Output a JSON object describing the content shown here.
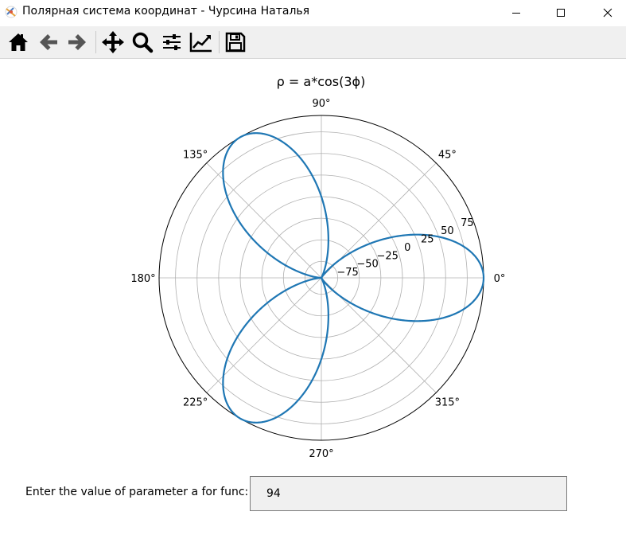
{
  "window": {
    "title": "Полярная система координат - Чурсина Наталья",
    "controls": [
      "minimize-icon",
      "maximize-icon",
      "close-icon"
    ]
  },
  "toolbar": {
    "tools": [
      {
        "name": "home",
        "icon": "home-icon"
      },
      {
        "name": "back",
        "icon": "arrow-left-icon"
      },
      {
        "name": "forward",
        "icon": "arrow-right-icon"
      },
      {
        "name": "pan",
        "icon": "move-icon"
      },
      {
        "name": "zoom",
        "icon": "zoom-icon"
      },
      {
        "name": "configure-subplots",
        "icon": "sliders-icon"
      },
      {
        "name": "edit-axis",
        "icon": "chart-line-icon"
      },
      {
        "name": "save",
        "icon": "floppy-disk-icon"
      }
    ]
  },
  "plot": {
    "title": "ρ = a*cos(3ϕ)",
    "line_color": "#1f77b4"
  },
  "chart_data": {
    "type": "line",
    "projection": "polar",
    "title": "ρ = a*cos(3ϕ)",
    "function": "rho = a*cos(3*phi)",
    "parameter_a": 94,
    "theta_ticks": [
      "0°",
      "45°",
      "90°",
      "135°",
      "180°",
      "225°",
      "270°",
      "315°"
    ],
    "theta_tick_values_deg": [
      0,
      45,
      90,
      135,
      180,
      225,
      270,
      315
    ],
    "r_ticks": [
      "−75",
      "−50",
      "−25",
      "0",
      "25",
      "50",
      "75"
    ],
    "r_tick_values": [
      -75,
      -50,
      -25,
      0,
      25,
      50,
      75
    ],
    "rlim": [
      -94,
      94
    ],
    "r_label_angle_deg": 22.5,
    "grid": true,
    "series": [
      {
        "color": "#1f77b4",
        "phi_range_deg": [
          0,
          360
        ]
      }
    ]
  },
  "controls": {
    "input_label": "Enter the value of parameter a for func:",
    "input_value": "94"
  },
  "colors": {
    "toolbar_bg": "#f0f0f0",
    "line": "#1f77b4",
    "grid": "#b0b0b0"
  }
}
